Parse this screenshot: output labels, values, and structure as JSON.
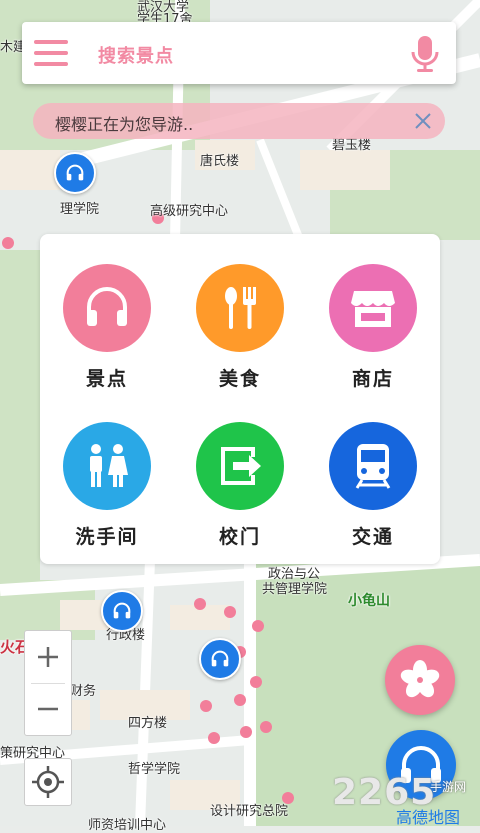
{
  "search": {
    "placeholder_label": "搜索景点"
  },
  "guide": {
    "message": "樱樱正在为您导游.."
  },
  "categories": [
    {
      "label": "景点",
      "color": "#f27e9a",
      "icon": "headphones-icon"
    },
    {
      "label": "美食",
      "color": "#ff9a2a",
      "icon": "fork-spoon-icon"
    },
    {
      "label": "商店",
      "color": "#ec6fb3",
      "icon": "shop-icon"
    },
    {
      "label": "洗手间",
      "color": "#2aa8e6",
      "icon": "restroom-icon"
    },
    {
      "label": "校门",
      "color": "#1fc44a",
      "icon": "exit-gate-icon"
    },
    {
      "label": "交通",
      "color": "#1666dd",
      "icon": "train-icon"
    }
  ],
  "map_labels": {
    "top1": "武汉大学",
    "top2": "学生17舍",
    "tl": "木建",
    "tangshi": "唐氏楼",
    "biyu": "碧玉楼",
    "lixue": "理学院",
    "gaoji": "高级研究中心",
    "zhengzhi": "政治与公",
    "gonggong": "共管理学院",
    "xiaoguishan": "小龟山",
    "huoshi": "火石",
    "xingzheng": "行政楼",
    "caiwu": "财务",
    "sifang": "四方楼",
    "cejing": "策研究中心",
    "zhexue": "哲学学院",
    "sheji": "设计研究总院",
    "peixun": "师资培训中心"
  },
  "watermark": {
    "brand": "2265",
    "site": "手游网",
    "map": "高德地图"
  },
  "colors": {
    "accent": "#f28aa3",
    "blue": "#1f7be6"
  }
}
